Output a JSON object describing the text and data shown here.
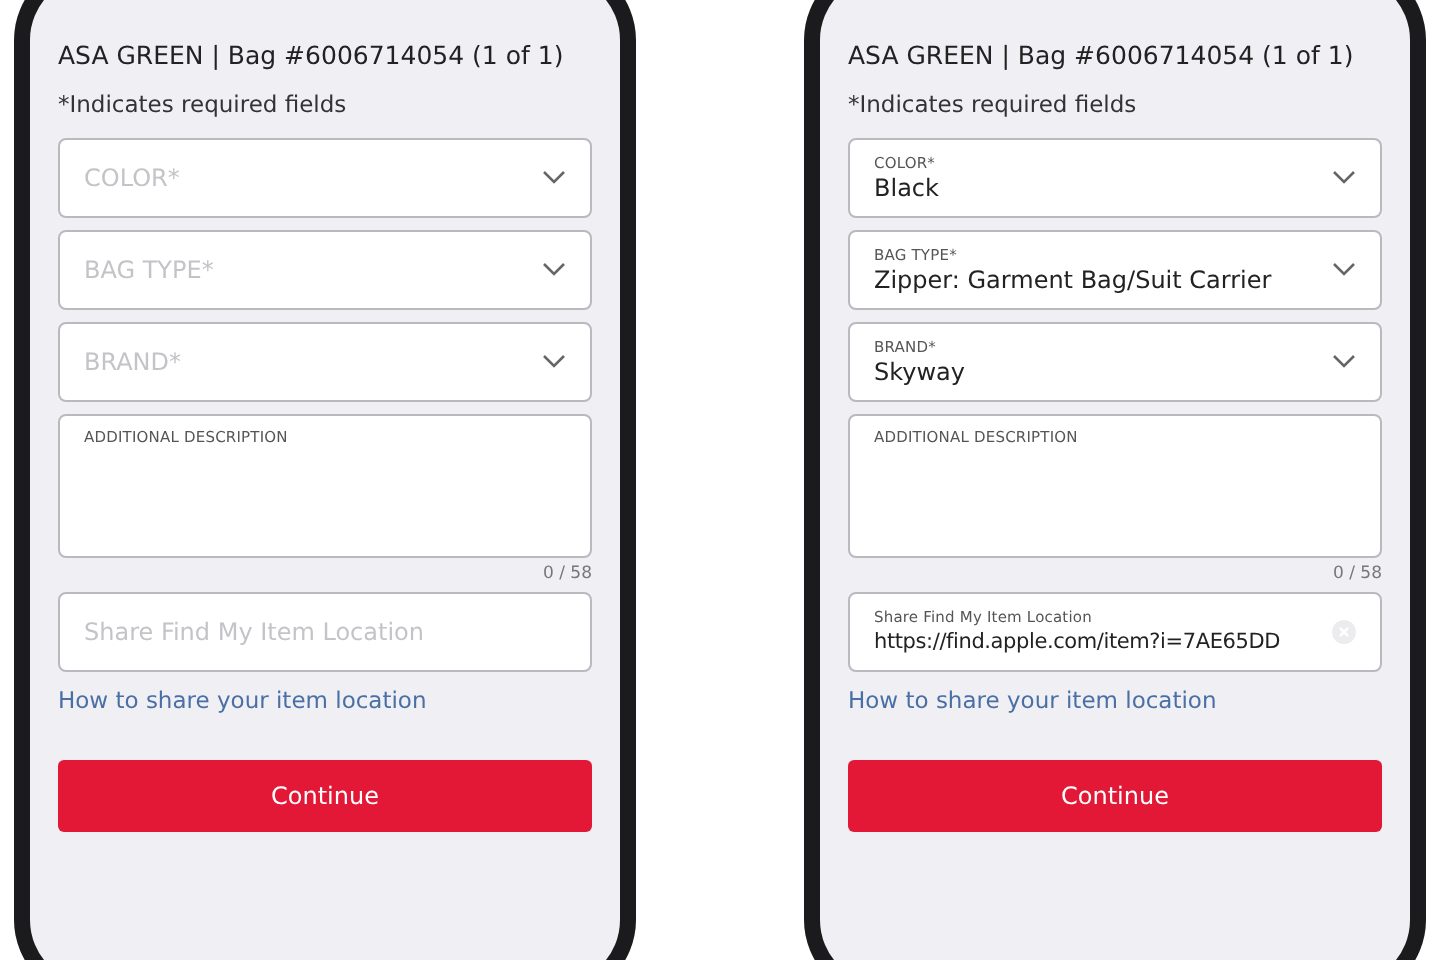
{
  "phones": [
    {
      "header": "ASA GREEN | Bag #6006714054 (1 of 1)",
      "required_note": "*Indicates required fields",
      "fields": [
        {
          "kind": "select",
          "placeholder": "COLOR*"
        },
        {
          "kind": "select",
          "placeholder": "BAG TYPE*"
        },
        {
          "kind": "select",
          "placeholder": "BRAND*"
        },
        {
          "kind": "textarea",
          "label": "ADDITIONAL DESCRIPTION",
          "counter": "0 / 58"
        },
        {
          "kind": "text",
          "placeholder": "Share Find My Item Location"
        }
      ],
      "link": "How to share your item location",
      "button": "Continue"
    },
    {
      "header": "ASA GREEN | Bag #6006714054 (1 of 1)",
      "required_note": "*Indicates required fields",
      "fields": [
        {
          "kind": "select",
          "label": "COLOR*",
          "value": "Black"
        },
        {
          "kind": "select",
          "label": "BAG TYPE*",
          "value": "Zipper: Garment Bag/Suit Carrier"
        },
        {
          "kind": "select",
          "label": "BRAND*",
          "value": "Skyway"
        },
        {
          "kind": "textarea",
          "label": "ADDITIONAL DESCRIPTION",
          "counter": "0 / 58"
        },
        {
          "kind": "text",
          "label": "Share Find My Item Location",
          "value": "https://find.apple.com/item?i=7AE65DD"
        }
      ],
      "link": "How to share your item location",
      "button": "Continue"
    }
  ]
}
